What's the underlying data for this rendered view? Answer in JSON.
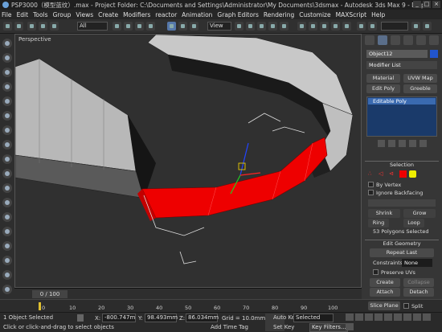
{
  "window": {
    "title": "PSP3000（模型蓝纹）.max   - Project Folder: C:\\Documents and Settings\\Administrator\\My Documents\\3dsmax    - Autodesk 3ds Max 9    - Disp"
  },
  "menu": [
    "File",
    "Edit",
    "Tools",
    "Group",
    "Views",
    "Create",
    "Modifiers",
    "reactor",
    "Animation",
    "Graph Editors",
    "Rendering",
    "Customize",
    "MAXScript",
    "Help"
  ],
  "toolbar": {
    "selection_filter": "All",
    "coord_system": "View"
  },
  "viewport": {
    "label": "Perspective"
  },
  "command_panel": {
    "object_name": "Object12",
    "object_color": "#2255cc",
    "modifier_list": "Modifier List",
    "mod_buttons": [
      "Material",
      "UVW Map",
      "Edit Poly",
      "Greeble"
    ],
    "stack_item": "Editable Poly",
    "selection": {
      "title": "Selection",
      "by_vertex": "By Vertex",
      "ignore_backfacing": "Ignore Backfacing",
      "shrink": "Shrink",
      "grow": "Grow",
      "ring": "Ring",
      "loop": "Loop",
      "status": "53 Polygons Selected"
    },
    "edit_geometry": {
      "title": "Edit Geometry",
      "repeat_last": "Repeat Last",
      "constraints_label": "Constraints:",
      "constraints_value": "None",
      "preserve_uvs": "Preserve UVs",
      "create": "Create",
      "collapse": "Collapse",
      "attach": "Attach",
      "detach": "Detach",
      "slice_plane": "Slice Plane",
      "split": "Split"
    }
  },
  "timeline": {
    "frame": "0 / 100",
    "ticks": [
      "0",
      "10",
      "20",
      "30",
      "40",
      "50",
      "60",
      "70",
      "80",
      "90",
      "100"
    ]
  },
  "status": {
    "selection_count": "1 Object Selected",
    "prompt": "Click or click-and-drag to select objects",
    "x_label": "X:",
    "x_value": "-800.747m",
    "y_label": "Y:",
    "y_value": "98.493mm",
    "z_label": "Z:",
    "z_value": "86.034mm",
    "grid": "Grid = 10.0mm",
    "add_time_tag": "Add Time Tag",
    "auto_key": "Auto Key",
    "set_key": "Set Key",
    "key_mode": "Selected",
    "key_filters": "Key Filters..."
  },
  "colors": {
    "selected_poly": "#ee0000",
    "ui_bg": "#363636",
    "stack_bg": "#1a3a6a"
  }
}
